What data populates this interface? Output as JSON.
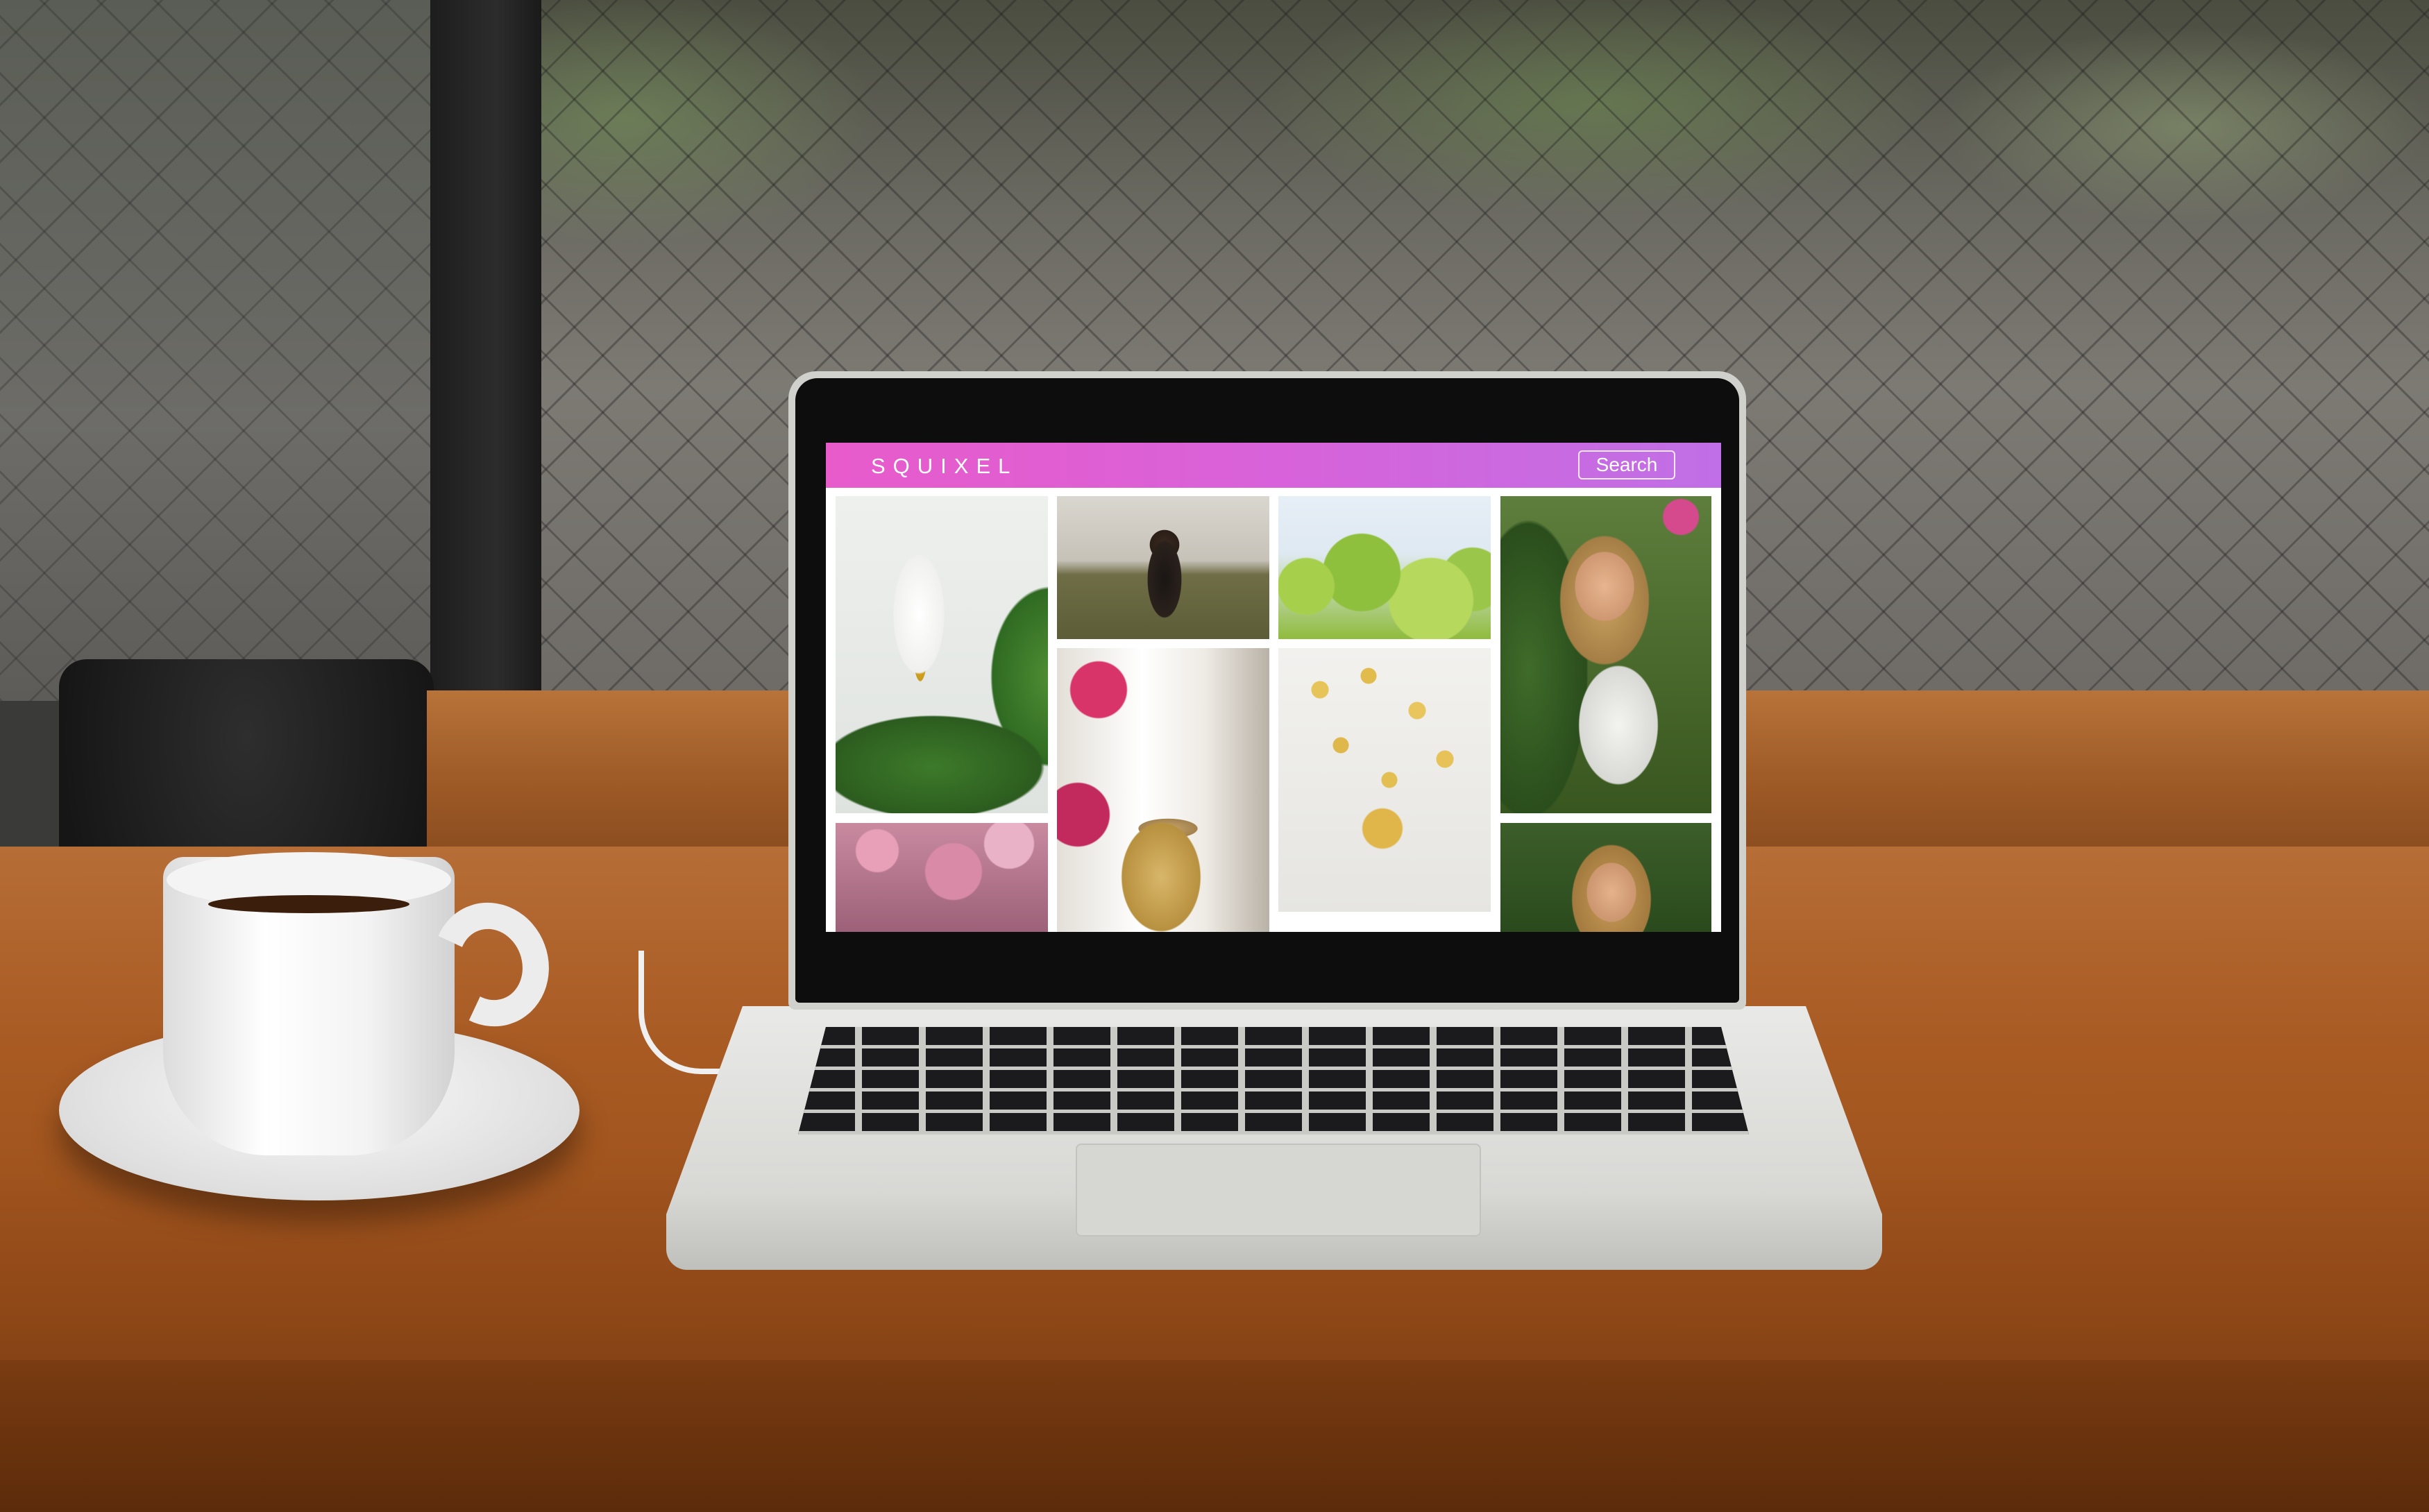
{
  "app": {
    "brand": "SQUIXEL",
    "search_label": "Search",
    "colors": {
      "header_gradient_start": "#e85bcb",
      "header_gradient_end": "#c06fe6",
      "header_text": "#ffffff",
      "gallery_background": "#ffffff"
    }
  },
  "gallery": {
    "tiles": [
      {
        "subject": "lily-leaf-photo"
      },
      {
        "subject": "woman-field-photo"
      },
      {
        "subject": "green-leaves-photo"
      },
      {
        "subject": "woman-flowers-photo"
      },
      {
        "subject": "pink-blossoms-photo"
      },
      {
        "subject": "woman-hat-street-photo"
      },
      {
        "subject": "yellow-petals-photo"
      },
      {
        "subject": "woman-greenery-photo"
      }
    ]
  }
}
